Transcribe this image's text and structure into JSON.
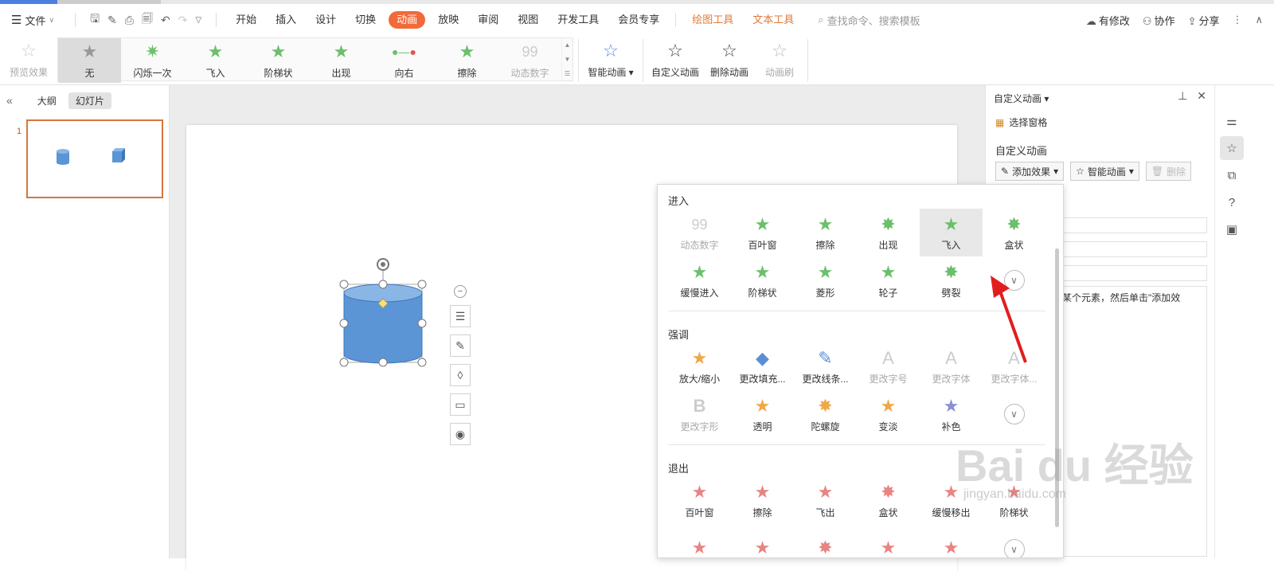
{
  "menubar": {
    "file": "文件",
    "tabs": [
      {
        "label": "开始"
      },
      {
        "label": "插入"
      },
      {
        "label": "设计"
      },
      {
        "label": "切换"
      },
      {
        "label": "动画",
        "active": true
      },
      {
        "label": "放映"
      },
      {
        "label": "审阅"
      },
      {
        "label": "视图"
      },
      {
        "label": "开发工具"
      },
      {
        "label": "会员专享"
      }
    ],
    "context_tabs": [
      {
        "label": "绘图工具"
      },
      {
        "label": "文本工具"
      }
    ],
    "search_placeholder": "查找命令、搜索模板",
    "right": {
      "modified": "有修改",
      "collaborate": "协作",
      "share": "分享"
    }
  },
  "ribbon": {
    "preview": "预览效果",
    "gallery": [
      {
        "label": "无",
        "icon": "star-gray"
      },
      {
        "label": "闪烁一次",
        "icon": "star-green"
      },
      {
        "label": "飞入",
        "icon": "star-green"
      },
      {
        "label": "阶梯状",
        "icon": "star-green"
      },
      {
        "label": "出现",
        "icon": "star-green"
      },
      {
        "label": "向右",
        "icon": "path-line"
      },
      {
        "label": "擦除",
        "icon": "star-green"
      },
      {
        "label": "动态数字",
        "icon": "digits",
        "dim": true
      }
    ],
    "smart": "智能动画",
    "custom": "自定义动画",
    "delete": "删除动画",
    "brush": "动画刷"
  },
  "leftpanel": {
    "outline": "大纲",
    "slides": "幻灯片",
    "slide_number": "1"
  },
  "dropdown": {
    "enter_title": "进入",
    "enter_items": [
      {
        "label": "动态数字",
        "dim": true
      },
      {
        "label": "百叶窗"
      },
      {
        "label": "擦除"
      },
      {
        "label": "出现"
      },
      {
        "label": "飞入",
        "highlight": true
      },
      {
        "label": "盒状"
      },
      {
        "label": "缓慢进入"
      },
      {
        "label": "阶梯状"
      },
      {
        "label": "菱形"
      },
      {
        "label": "轮子"
      },
      {
        "label": "劈裂"
      }
    ],
    "emphasis_title": "强调",
    "emphasis_items": [
      {
        "label": "放大/缩小"
      },
      {
        "label": "更改填充..."
      },
      {
        "label": "更改线条..."
      },
      {
        "label": "更改字号",
        "dim": true
      },
      {
        "label": "更改字体",
        "dim": true
      },
      {
        "label": "更改字体...",
        "dim": true
      },
      {
        "label": "更改字形",
        "dim": true
      },
      {
        "label": "透明"
      },
      {
        "label": "陀螺旋"
      },
      {
        "label": "变淡"
      },
      {
        "label": "补色"
      }
    ],
    "exit_title": "退出",
    "exit_items": [
      {
        "label": "百叶窗"
      },
      {
        "label": "擦除"
      },
      {
        "label": "飞出"
      },
      {
        "label": "盒状"
      },
      {
        "label": "缓慢移出"
      },
      {
        "label": "阶梯状"
      }
    ]
  },
  "rpanel": {
    "title": "自定义动画",
    "select_pane": "选择窗格",
    "subtitle": "自定义动画",
    "add_effect": "添加效果",
    "smart": "智能动画",
    "delete": "删除",
    "hint": "某个元素，然后单击\"添加效"
  },
  "watermark": {
    "main": "Bai du 经验",
    "url": "jingyan.baidu.com"
  },
  "colors": {
    "accent": "#f26a3a",
    "shape": "#5b95d5",
    "enter": "#6cbf6c",
    "exit": "#e88484",
    "emphasis": "#f0a848"
  }
}
